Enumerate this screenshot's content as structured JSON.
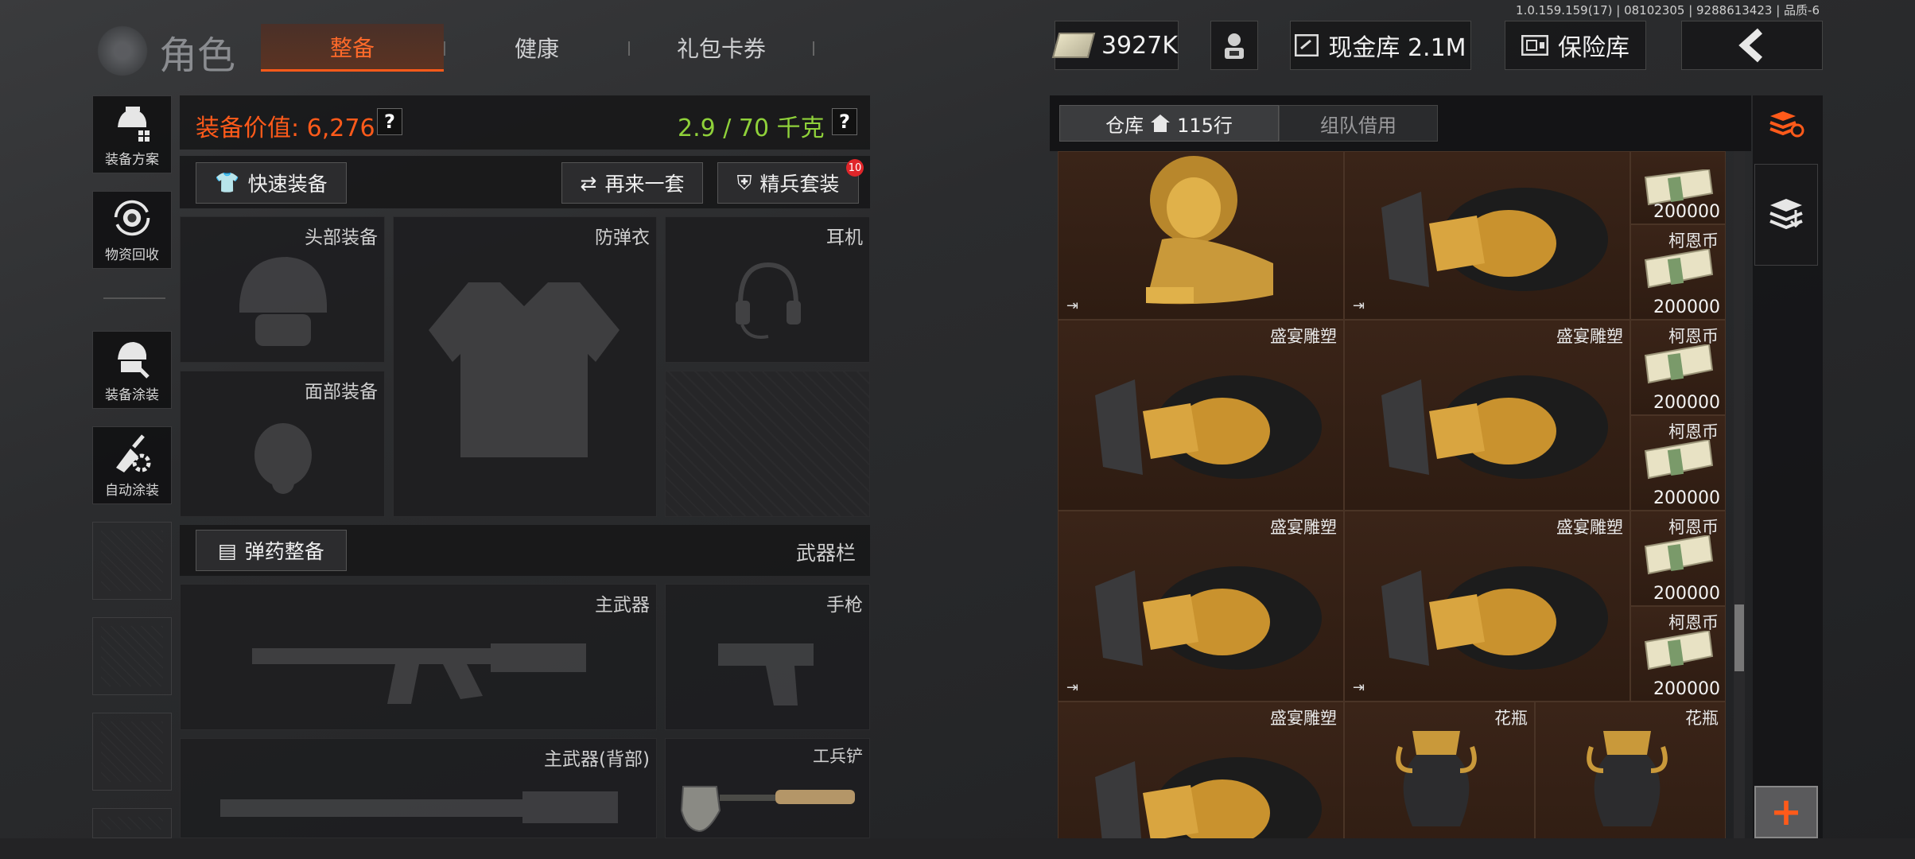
{
  "version_text": "1.0.159.159(17) | 08102305 | 9288613423 | 品质-6",
  "header": {
    "title": "角色",
    "tabs": [
      {
        "label": "整备",
        "active": true
      },
      {
        "label": "健康",
        "active": false
      },
      {
        "label": "礼包卡券",
        "active": false
      }
    ],
    "currency": "3927K",
    "cash_vault": "现金库 2.1M",
    "safe_label": "保险库",
    "back_icon": "chevron-left-icon"
  },
  "left_nav": [
    {
      "label": "装备方案",
      "icon": "helmet-grid-icon"
    },
    {
      "label": "物资回收",
      "icon": "recycle-icon"
    },
    {
      "label": "装备涂装",
      "icon": "paint-icon"
    },
    {
      "label": "自动涂装",
      "icon": "auto-paint-icon"
    }
  ],
  "equipment": {
    "value_label": "装备价值: 6,276",
    "weight_label": "2.9 / 70 千克",
    "quick_equip": "快速装备",
    "again_set": "再来一套",
    "elite_set": "精兵套装",
    "elite_badge": "10",
    "slots": {
      "head": "头部装备",
      "armor": "防弹衣",
      "headset": "耳机",
      "face": "面部装备"
    },
    "ammo_button": "弹药整备",
    "weapon_bar": "武器栏",
    "weapons": {
      "primary": "主武器",
      "pistol": "手枪",
      "primary_back": "主武器(背部)",
      "shovel": "工兵铲"
    }
  },
  "warehouse": {
    "tab_warehouse": "仓库",
    "rows": "115行",
    "tab_team": "组队借用",
    "item_banquet": "盛宴雕塑",
    "item_coin": "柯恩币",
    "coin_value": "200000",
    "item_vase": "花瓶",
    "add_label": "+"
  },
  "colors": {
    "accent_orange": "#ff5a1a",
    "weight_green": "#8fd13a",
    "cell_brown": "#3a2418"
  }
}
